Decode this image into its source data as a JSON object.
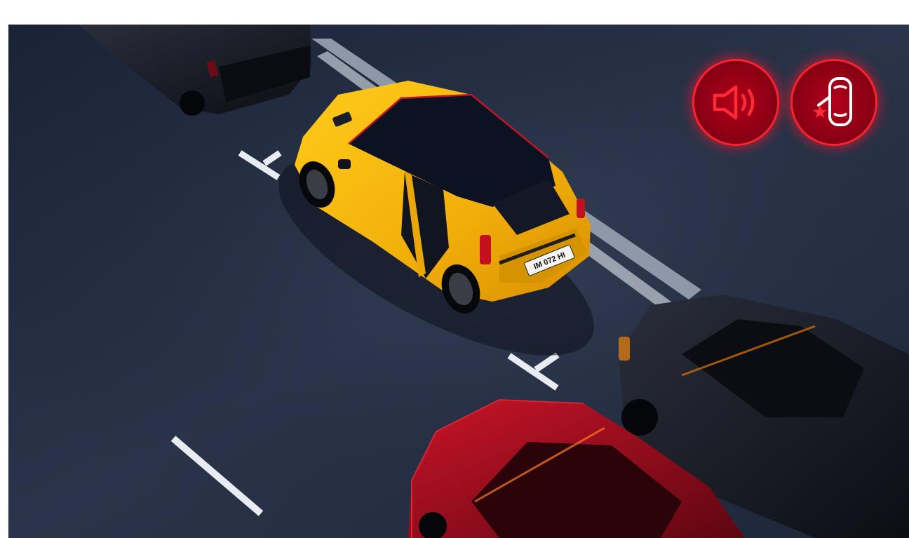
{
  "scene": {
    "license_plate": "IM 072 HI"
  },
  "alert_icons": [
    {
      "name": "speaker-warning-icon",
      "color": "#ff2a36"
    },
    {
      "name": "door-open-warning-icon",
      "color": "#ffffff",
      "accent": "#ff2a36"
    }
  ],
  "colors": {
    "road": "#222c3f",
    "yellow_car": "#f3b50c",
    "red_car": "#9b0d1c",
    "black_car": "#151821",
    "alert_red": "#d4001f"
  }
}
